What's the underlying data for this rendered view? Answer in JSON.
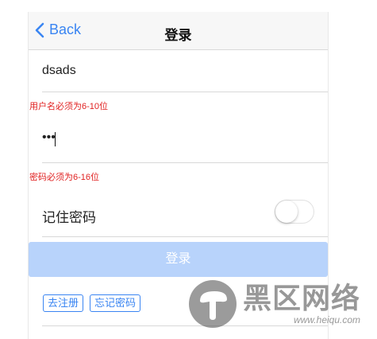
{
  "navbar": {
    "back_label": "Back",
    "title": "登录"
  },
  "form": {
    "username_value": "dsads",
    "username_error": "用户名必须为6-10位",
    "password_dots": "•••",
    "password_error": "密码必须为6-16位",
    "remember_label": "记住密码",
    "remember_on": false,
    "login_label": "登录"
  },
  "links": {
    "register": "去注册",
    "forgot": "忘记密码"
  },
  "watermark": {
    "name": "黑区网络",
    "url": "www.heiqu.com"
  },
  "colors": {
    "accent": "#3a85f2",
    "error": "#e02020",
    "button_disabled": "#b8d3fb"
  }
}
